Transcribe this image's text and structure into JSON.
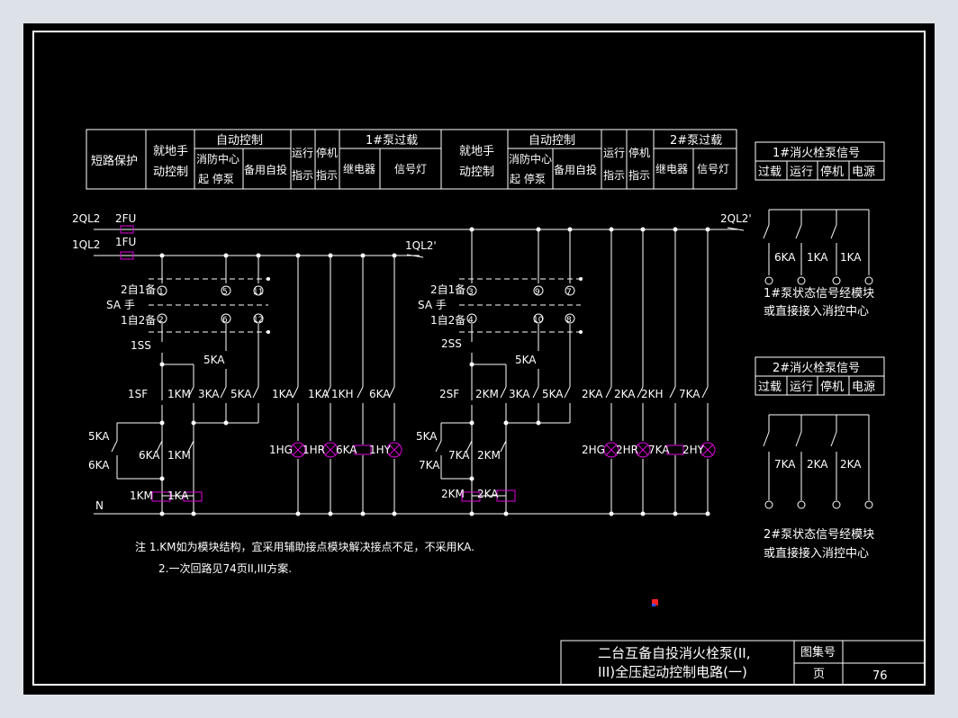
{
  "colors": {
    "background": "#000000",
    "page_bg": "#dde2e8",
    "line": "#ffffff",
    "component": "#e000e0",
    "text": "#ffffff",
    "marker": "#ff2020"
  },
  "header_table_left": {
    "short_circuit": "短路保护",
    "local_manual_1": "就地手",
    "local_manual_2": "动控制",
    "auto_control": "自动控制",
    "fire_center_1": "消防中心",
    "fire_center_2": "起 停泵",
    "standby": "备用自投",
    "run_1": "运行",
    "run_2": "指示",
    "stop_1": "停机",
    "stop_2": "指示",
    "overload": "1#泵过载",
    "relay": "继电器",
    "signal_lamp": "信号灯"
  },
  "header_table_right": {
    "local_manual_1": "就地手",
    "local_manual_2": "动控制",
    "auto_control": "自动控制",
    "fire_center_1": "消防中心",
    "fire_center_2": "起 停泵",
    "standby": "备用自投",
    "run_1": "运行",
    "run_2": "指示",
    "stop_1": "停机",
    "stop_2": "指示",
    "overload": "2#泵过载",
    "relay": "继电器",
    "signal_lamp": "信号灯"
  },
  "signal_table_1": {
    "title": "1#消火栓泵信号",
    "cells": [
      "过载",
      "运行",
      "停机",
      "电源"
    ],
    "contacts": [
      "6KA",
      "1KA",
      "1KA"
    ],
    "note_1": "1#泵状态信号经模块",
    "note_2": "或直接接入消控中心"
  },
  "signal_table_2": {
    "title": "2#消火栓泵信号",
    "cells": [
      "过载",
      "运行",
      "停机",
      "电源"
    ],
    "contacts": [
      "7KA",
      "2KA",
      "2KA"
    ],
    "note_1": "2#泵状态信号经模块",
    "note_2": "或直接接入消控中心"
  },
  "circuit_labels": {
    "ql2_2": "2QL2",
    "ql2_1": "1QL2",
    "fu2": "2FU",
    "fu1": "1FU",
    "ql2_1_end": "1QL2'",
    "ql2_2_end": "2QL2'",
    "n": "N",
    "sa_left_top": "2自1备",
    "sa_left_mid": "SA  手",
    "sa_left_bot": "1自2备",
    "sa_right_top": "2自1备",
    "sa_right_mid": "SA  手",
    "sa_right_bot": "1自2备",
    "ss1": "1SS",
    "ss2": "2SS",
    "sf1": "1SF",
    "sf2": "2SF",
    "left": {
      "ka5_top": "5KA",
      "km1": "1KM",
      "ka3": "3KA",
      "ka5": "5KA",
      "ka5_side": "5KA",
      "ka6_side": "6KA",
      "ka6": "6KA",
      "km1_lower": "1KM",
      "coil_km": "1KM",
      "coil_ka": "1KA",
      "ka1_a": "1KA",
      "ka1_b": "1KA",
      "kh1": "1KH",
      "ka6_c": "6KA",
      "hg": "1HG",
      "hr": "1HR",
      "ka6_coil": "6KA",
      "hy": "1HY",
      "sa_nums_top": [
        "1",
        "5",
        "11"
      ],
      "sa_nums_bot": [
        "2",
        "6",
        "12"
      ]
    },
    "right": {
      "ka5_top": "5KA",
      "km2": "2KM",
      "ka3": "3KA",
      "ka5": "5KA",
      "ka5_side": "5KA",
      "ka7_side": "7KA",
      "ka7": "7KA",
      "km2_lower": "2KM",
      "coil_km": "2KM",
      "coil_ka": "2KA",
      "ka2_a": "2KA",
      "ka2_b": "2KA",
      "kh2": "2KH",
      "ka7_c": "7KA",
      "hg": "2HG",
      "hr": "2HR",
      "ka7_coil": "7KA",
      "hy": "2HY",
      "sa_nums_top": [
        "3",
        "9",
        "7"
      ],
      "sa_nums_bot": [
        "4",
        "10",
        "8"
      ]
    }
  },
  "notes": {
    "line1": "注  1.KM如为模块结构，宜采用辅助接点模块解决接点不足，不采用KA.",
    "line2": "2.一次回路见74页II,III方案."
  },
  "title_block": {
    "title_1": "二台互备自投消火栓泵(II,",
    "title_2": "III)全压起动控制电路(一)",
    "atlas_label": "图集号",
    "atlas_value": "",
    "page_label": "页",
    "page_value": "76"
  }
}
